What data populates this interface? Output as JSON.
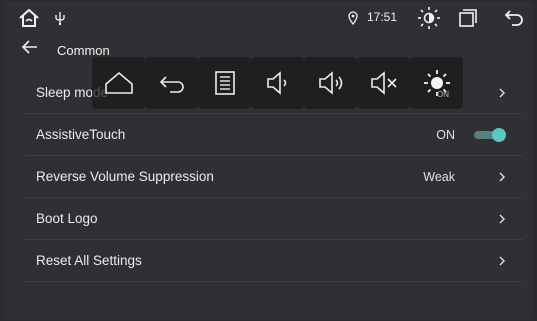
{
  "status": {
    "time": "17:51"
  },
  "header": {
    "title": "Common"
  },
  "rows": [
    {
      "label": "Sleep mode",
      "value": ""
    },
    {
      "label": "AssistiveTouch",
      "value": "ON"
    },
    {
      "label": "Reverse Volume Suppression",
      "value": "Weak"
    },
    {
      "label": "Boot Logo",
      "value": ""
    },
    {
      "label": "Reset All Settings",
      "value": ""
    }
  ],
  "quickbar": {
    "brightness_badge": "ON"
  },
  "colors": {
    "accent": "#5cc8c3",
    "background": "#2f3033"
  }
}
